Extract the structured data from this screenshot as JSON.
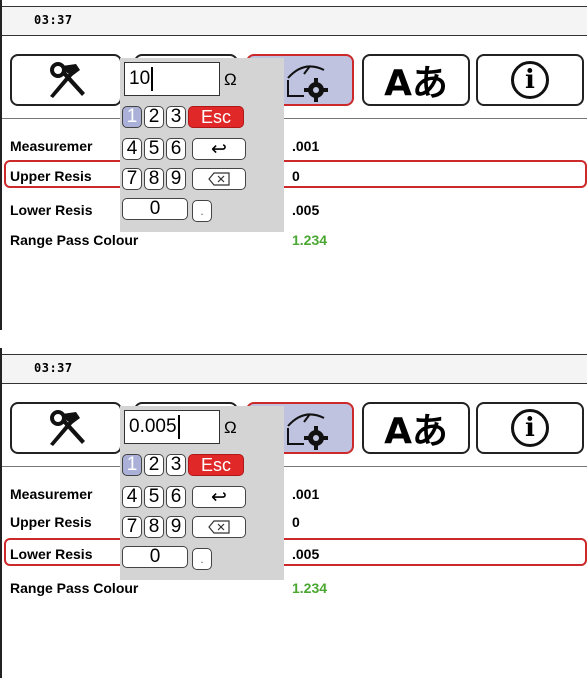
{
  "screens": [
    {
      "clock": "03:37",
      "keypad": {
        "input_value": "10",
        "unit": "Ω"
      },
      "selected_row": 1,
      "rows": [
        {
          "label": "Measuremer",
          "value": ".001"
        },
        {
          "label": "Upper Resis",
          "value": "0"
        },
        {
          "label": "Lower Resis",
          "value": ".005"
        },
        {
          "label": "Range Pass Colour",
          "value": "1.234"
        }
      ]
    },
    {
      "clock": "03:37",
      "keypad": {
        "input_value": "0.005",
        "unit": "Ω"
      },
      "selected_row": 2,
      "rows": [
        {
          "label": "Measuremer",
          "value": ".001"
        },
        {
          "label": "Upper Resis",
          "value": "0"
        },
        {
          "label": "Lower Resis",
          "value": ".005"
        },
        {
          "label": "Range Pass Colour",
          "value": "1.234"
        }
      ]
    }
  ],
  "tabs": {
    "tools_icon": "hammer-wrench-icon",
    "settings_icon": "gauge-gear-icon",
    "language_label": "Aあ",
    "info_label": "i"
  },
  "keypad_keys": {
    "row1": [
      "1",
      "2",
      "3"
    ],
    "esc": "Esc",
    "row2": [
      "4",
      "5",
      "6"
    ],
    "enter": "↩",
    "row3": [
      "7",
      "8",
      "9"
    ],
    "backspace_icon": "backspace-icon",
    "zero": "0",
    "dot": "."
  },
  "colors": {
    "active_tab": "#bfc3e0",
    "selection_border": "#cc2a2a",
    "esc_key": "#e02828",
    "pass_value": "#4aa832",
    "keypad_bg": "#d4d4d4"
  }
}
